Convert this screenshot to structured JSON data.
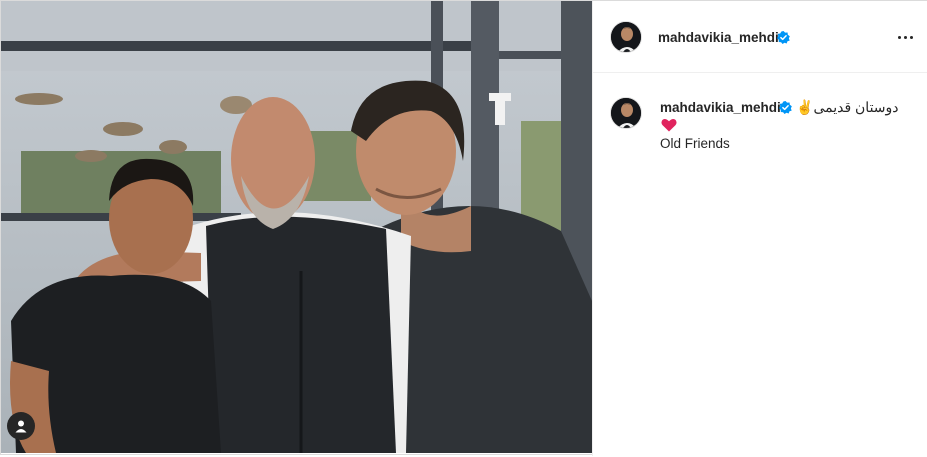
{
  "post": {
    "username": "mahdavikia_mehdi",
    "verified": true,
    "caption_persian": "دوستان قدیمی",
    "caption_emoji": "✌",
    "caption_english": "Old Friends"
  },
  "icons": {
    "tag": "person-tag-icon",
    "more": "more-options-icon",
    "verified": "verified-badge-icon",
    "heart": "red-heart-emoji"
  },
  "colors": {
    "verified_blue": "#0095f6",
    "heart_red": "#e0245e",
    "text": "#262626"
  }
}
